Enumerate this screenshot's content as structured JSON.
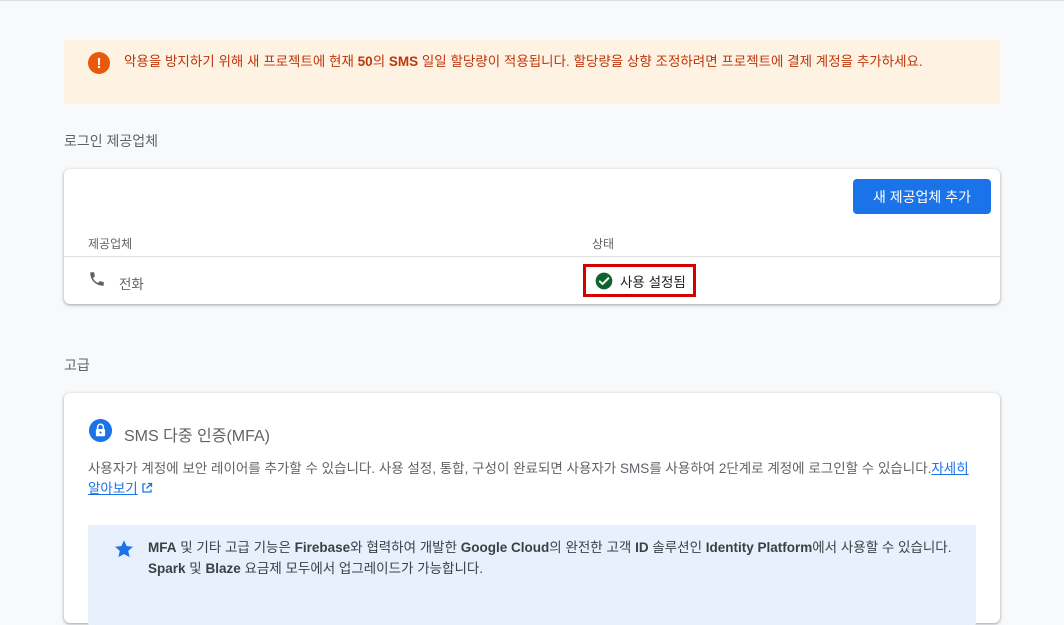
{
  "warning": {
    "icon": "exclamation-icon",
    "parts": [
      {
        "t": "악용을 방지하기 위해 새 프로젝트에 현재 ",
        "b": false
      },
      {
        "t": "50",
        "b": true
      },
      {
        "t": "의 ",
        "b": false
      },
      {
        "t": "SMS",
        "b": true
      },
      {
        "t": " 일일 할당량이 적용됩니다. 할당량을 상향 조정하려면 프로젝트에 결제 계정을 추가하세요.",
        "b": false
      }
    ]
  },
  "providers": {
    "section_title": "로그인 제공업체",
    "add_button": "새 제공업체 추가",
    "columns": {
      "provider": "제공업체",
      "status": "상태"
    },
    "rows": [
      {
        "icon": "phone-icon",
        "name": "전화",
        "status": "사용 설정됨",
        "status_icon": "check-circle-icon"
      }
    ]
  },
  "advanced": {
    "section_title": "고급",
    "mfa": {
      "icon": "lock-icon",
      "title": "SMS 다중 인증(MFA)",
      "description": "사용자가 계정에 보안 레이어를 추가할 수 있습니다. 사용 설정, 통합, 구성이 완료되면 사용자가 SMS를 사용하여 2단계로 계정에 로그인할 수 있습니다.",
      "learn_more": "자세히 알아보기",
      "info": {
        "icon": "star-icon",
        "parts": [
          {
            "t": "MFA",
            "b": true
          },
          {
            "t": " 및 기타 고급 기능은 ",
            "b": false
          },
          {
            "t": "Firebase",
            "b": true
          },
          {
            "t": "와 협력하여 개발한 ",
            "b": false
          },
          {
            "t": "Google Cloud",
            "b": true
          },
          {
            "t": "의 완전한 고객 ",
            "b": false
          },
          {
            "t": "ID",
            "b": true
          },
          {
            "t": " 솔루션인 ",
            "b": false
          },
          {
            "t": "Identity Platform",
            "b": true
          },
          {
            "t": "에서 사용할 수 있습니다. ",
            "b": false
          },
          {
            "t": "Spark",
            "b": true
          },
          {
            "t": " 및 ",
            "b": false
          },
          {
            "t": "Blaze",
            "b": true
          },
          {
            "t": " 요금제 모두에서 업그레이드가 가능합니다.",
            "b": false
          }
        ]
      }
    }
  },
  "colors": {
    "accent": "#1a73e8",
    "warning_bg": "#fef3e2",
    "warning_text": "#bf360c",
    "enabled_check": "#137333",
    "highlight_box": "#d50000"
  }
}
